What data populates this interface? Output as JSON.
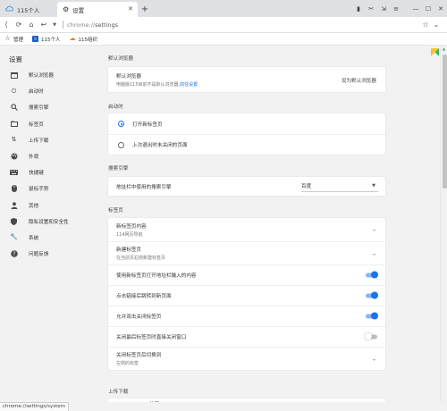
{
  "tabs": [
    {
      "label": "115个人",
      "icon": "cloud-icon",
      "active": false
    },
    {
      "label": "设置",
      "icon": "gear-icon",
      "active": true
    }
  ],
  "address": {
    "scheme": "chrome://",
    "path": "settings"
  },
  "bookmarks": [
    {
      "label": "管理",
      "icon": "star-icon"
    },
    {
      "label": "115个人",
      "icon": "115-logo-icon"
    },
    {
      "label": "115组织",
      "icon": "cloud-icon"
    }
  ],
  "sidebar": {
    "title": "设置",
    "items": [
      {
        "label": "默认浏览器",
        "icon": "browser-icon"
      },
      {
        "label": "启动时",
        "icon": "power-icon"
      },
      {
        "label": "搜索引擎",
        "icon": "search-icon"
      },
      {
        "label": "标签页",
        "icon": "tab-icon"
      },
      {
        "label": "上传下载",
        "icon": "transfer-icon"
      },
      {
        "label": "外观",
        "icon": "palette-icon"
      },
      {
        "label": "快捷键",
        "icon": "keyboard-icon"
      },
      {
        "label": "鼠标手势",
        "icon": "mouse-icon"
      },
      {
        "label": "其他",
        "icon": "person-icon"
      },
      {
        "label": "隐私设置和安全性",
        "icon": "shield-icon"
      },
      {
        "label": "系统",
        "icon": "wrench-icon"
      },
      {
        "label": "问题反馈",
        "icon": "help-icon"
      }
    ]
  },
  "sections": {
    "default_browser": {
      "title": "默认浏览器",
      "row_title": "默认浏览器",
      "row_sub_text": "电脑版115目前不是默认浏览器,",
      "row_sub_link": "前往设置",
      "action": "设为默认浏览器"
    },
    "startup": {
      "title": "启动时",
      "options": [
        "打开新标签页",
        "上次退出时未关闭的页面"
      ],
      "selected": 0
    },
    "search": {
      "title": "搜索引擎",
      "row_label": "地址栏中使用的搜索引擎",
      "selected": "百度"
    },
    "tabs": {
      "title": "标签页",
      "rows": [
        {
          "label": "新标签页内容",
          "sub": "114网页导航",
          "control": "chevron"
        },
        {
          "label": "新建标签页",
          "sub": "在当前页右侧新建标签页",
          "control": "chevron"
        },
        {
          "label": "使用新标签页打开地址栏输入的内容",
          "control": "toggle",
          "on": true
        },
        {
          "label": "点击链接后跳转到新页面",
          "control": "toggle",
          "on": true
        },
        {
          "label": "允许双击关闭标签页",
          "control": "toggle",
          "on": true
        },
        {
          "label": "关闭最后标签页时直接关闭窗口",
          "control": "toggle",
          "on": false
        },
        {
          "label": "关闭标签页后切换到",
          "sub": "左侧的标签",
          "control": "chevron"
        }
      ]
    },
    "downloads": {
      "title": "上传下载",
      "peek_text": "位置"
    }
  },
  "status_url": "chrome://settings/system",
  "colors": {
    "accent": "#1a73e8",
    "toggle_track": "#8ab4f8",
    "background": "#f2f2f2",
    "card": "#ffffff"
  }
}
